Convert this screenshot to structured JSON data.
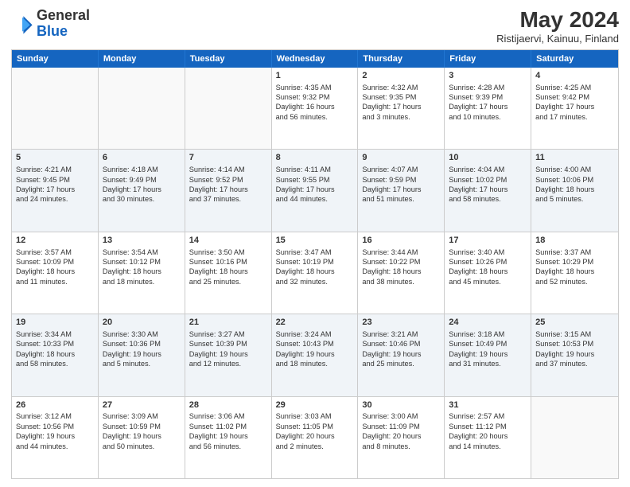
{
  "logo": {
    "general": "General",
    "blue": "Blue"
  },
  "title": "May 2024",
  "subtitle": "Ristijaervi, Kainuu, Finland",
  "header_days": [
    "Sunday",
    "Monday",
    "Tuesday",
    "Wednesday",
    "Thursday",
    "Friday",
    "Saturday"
  ],
  "weeks": [
    [
      {
        "day": "",
        "info": ""
      },
      {
        "day": "",
        "info": ""
      },
      {
        "day": "",
        "info": ""
      },
      {
        "day": "1",
        "info": "Sunrise: 4:35 AM\nSunset: 9:32 PM\nDaylight: 16 hours\nand 56 minutes."
      },
      {
        "day": "2",
        "info": "Sunrise: 4:32 AM\nSunset: 9:35 PM\nDaylight: 17 hours\nand 3 minutes."
      },
      {
        "day": "3",
        "info": "Sunrise: 4:28 AM\nSunset: 9:39 PM\nDaylight: 17 hours\nand 10 minutes."
      },
      {
        "day": "4",
        "info": "Sunrise: 4:25 AM\nSunset: 9:42 PM\nDaylight: 17 hours\nand 17 minutes."
      }
    ],
    [
      {
        "day": "5",
        "info": "Sunrise: 4:21 AM\nSunset: 9:45 PM\nDaylight: 17 hours\nand 24 minutes."
      },
      {
        "day": "6",
        "info": "Sunrise: 4:18 AM\nSunset: 9:49 PM\nDaylight: 17 hours\nand 30 minutes."
      },
      {
        "day": "7",
        "info": "Sunrise: 4:14 AM\nSunset: 9:52 PM\nDaylight: 17 hours\nand 37 minutes."
      },
      {
        "day": "8",
        "info": "Sunrise: 4:11 AM\nSunset: 9:55 PM\nDaylight: 17 hours\nand 44 minutes."
      },
      {
        "day": "9",
        "info": "Sunrise: 4:07 AM\nSunset: 9:59 PM\nDaylight: 17 hours\nand 51 minutes."
      },
      {
        "day": "10",
        "info": "Sunrise: 4:04 AM\nSunset: 10:02 PM\nDaylight: 17 hours\nand 58 minutes."
      },
      {
        "day": "11",
        "info": "Sunrise: 4:00 AM\nSunset: 10:06 PM\nDaylight: 18 hours\nand 5 minutes."
      }
    ],
    [
      {
        "day": "12",
        "info": "Sunrise: 3:57 AM\nSunset: 10:09 PM\nDaylight: 18 hours\nand 11 minutes."
      },
      {
        "day": "13",
        "info": "Sunrise: 3:54 AM\nSunset: 10:12 PM\nDaylight: 18 hours\nand 18 minutes."
      },
      {
        "day": "14",
        "info": "Sunrise: 3:50 AM\nSunset: 10:16 PM\nDaylight: 18 hours\nand 25 minutes."
      },
      {
        "day": "15",
        "info": "Sunrise: 3:47 AM\nSunset: 10:19 PM\nDaylight: 18 hours\nand 32 minutes."
      },
      {
        "day": "16",
        "info": "Sunrise: 3:44 AM\nSunset: 10:22 PM\nDaylight: 18 hours\nand 38 minutes."
      },
      {
        "day": "17",
        "info": "Sunrise: 3:40 AM\nSunset: 10:26 PM\nDaylight: 18 hours\nand 45 minutes."
      },
      {
        "day": "18",
        "info": "Sunrise: 3:37 AM\nSunset: 10:29 PM\nDaylight: 18 hours\nand 52 minutes."
      }
    ],
    [
      {
        "day": "19",
        "info": "Sunrise: 3:34 AM\nSunset: 10:33 PM\nDaylight: 18 hours\nand 58 minutes."
      },
      {
        "day": "20",
        "info": "Sunrise: 3:30 AM\nSunset: 10:36 PM\nDaylight: 19 hours\nand 5 minutes."
      },
      {
        "day": "21",
        "info": "Sunrise: 3:27 AM\nSunset: 10:39 PM\nDaylight: 19 hours\nand 12 minutes."
      },
      {
        "day": "22",
        "info": "Sunrise: 3:24 AM\nSunset: 10:43 PM\nDaylight: 19 hours\nand 18 minutes."
      },
      {
        "day": "23",
        "info": "Sunrise: 3:21 AM\nSunset: 10:46 PM\nDaylight: 19 hours\nand 25 minutes."
      },
      {
        "day": "24",
        "info": "Sunrise: 3:18 AM\nSunset: 10:49 PM\nDaylight: 19 hours\nand 31 minutes."
      },
      {
        "day": "25",
        "info": "Sunrise: 3:15 AM\nSunset: 10:53 PM\nDaylight: 19 hours\nand 37 minutes."
      }
    ],
    [
      {
        "day": "26",
        "info": "Sunrise: 3:12 AM\nSunset: 10:56 PM\nDaylight: 19 hours\nand 44 minutes."
      },
      {
        "day": "27",
        "info": "Sunrise: 3:09 AM\nSunset: 10:59 PM\nDaylight: 19 hours\nand 50 minutes."
      },
      {
        "day": "28",
        "info": "Sunrise: 3:06 AM\nSunset: 11:02 PM\nDaylight: 19 hours\nand 56 minutes."
      },
      {
        "day": "29",
        "info": "Sunrise: 3:03 AM\nSunset: 11:05 PM\nDaylight: 20 hours\nand 2 minutes."
      },
      {
        "day": "30",
        "info": "Sunrise: 3:00 AM\nSunset: 11:09 PM\nDaylight: 20 hours\nand 8 minutes."
      },
      {
        "day": "31",
        "info": "Sunrise: 2:57 AM\nSunset: 11:12 PM\nDaylight: 20 hours\nand 14 minutes."
      },
      {
        "day": "",
        "info": ""
      }
    ]
  ]
}
